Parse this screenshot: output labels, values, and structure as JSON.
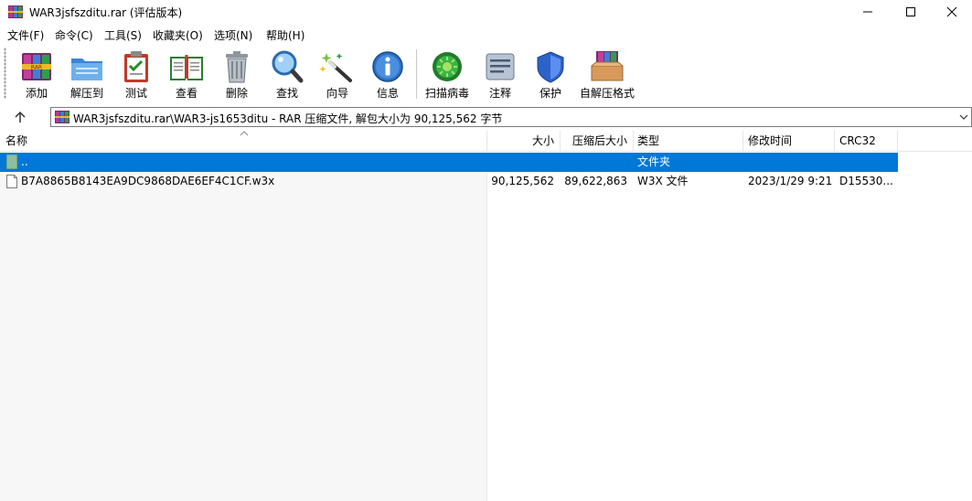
{
  "window": {
    "title": "WAR3jsfszditu.rar (评估版本)",
    "icon": "winrar-archive-icon",
    "controls": [
      "minimize",
      "maximize",
      "close"
    ]
  },
  "menu": [
    {
      "label": "文件(F)"
    },
    {
      "label": "命令(C)"
    },
    {
      "label": "工具(S)"
    },
    {
      "label": "收藏夹(O)"
    },
    {
      "label": "选项(N)"
    },
    {
      "label": "帮助(H)"
    }
  ],
  "toolbar": [
    {
      "label": "添加",
      "icon": "add-archive-icon"
    },
    {
      "label": "解压到",
      "icon": "extract-to-icon"
    },
    {
      "label": "测试",
      "icon": "test-clipboard-icon"
    },
    {
      "label": "查看",
      "icon": "view-book-icon"
    },
    {
      "label": "删除",
      "icon": "delete-trash-icon"
    },
    {
      "label": "查找",
      "icon": "find-magnifier-icon"
    },
    {
      "label": "向导",
      "icon": "wizard-wand-icon"
    },
    {
      "label": "信息",
      "icon": "info-icon"
    },
    {
      "label": "扫描病毒",
      "icon": "scan-virus-icon"
    },
    {
      "label": "注释",
      "icon": "comment-icon"
    },
    {
      "label": "保护",
      "icon": "protect-shield-icon"
    },
    {
      "label": "自解压格式",
      "icon": "sfx-box-icon"
    }
  ],
  "address": {
    "text": "WAR3jsfszditu.rar\\WAR3-js1653ditu - RAR 压缩文件, 解包大小为 90,125,562 字节"
  },
  "columns": {
    "name": "名称",
    "size": "大小",
    "packed": "压缩后大小",
    "type": "类型",
    "modified": "修改时间",
    "crc": "CRC32"
  },
  "rows": [
    {
      "name": "..",
      "size": "",
      "packed": "",
      "type": "文件夹",
      "modified": "",
      "crc": "",
      "selected": true,
      "icon": "parent-folder-icon"
    },
    {
      "name": "B7A8865B8143EA9DC9868DAE6EF4C1CF.w3x",
      "size": "90,125,562",
      "packed": "89,622,863",
      "type": "W3X 文件",
      "modified": "2023/1/29 9:21",
      "crc": "D15530...",
      "selected": false,
      "icon": "file-icon"
    }
  ],
  "colors": {
    "selection": "#0078d7",
    "window_bg": "#ffffff"
  }
}
